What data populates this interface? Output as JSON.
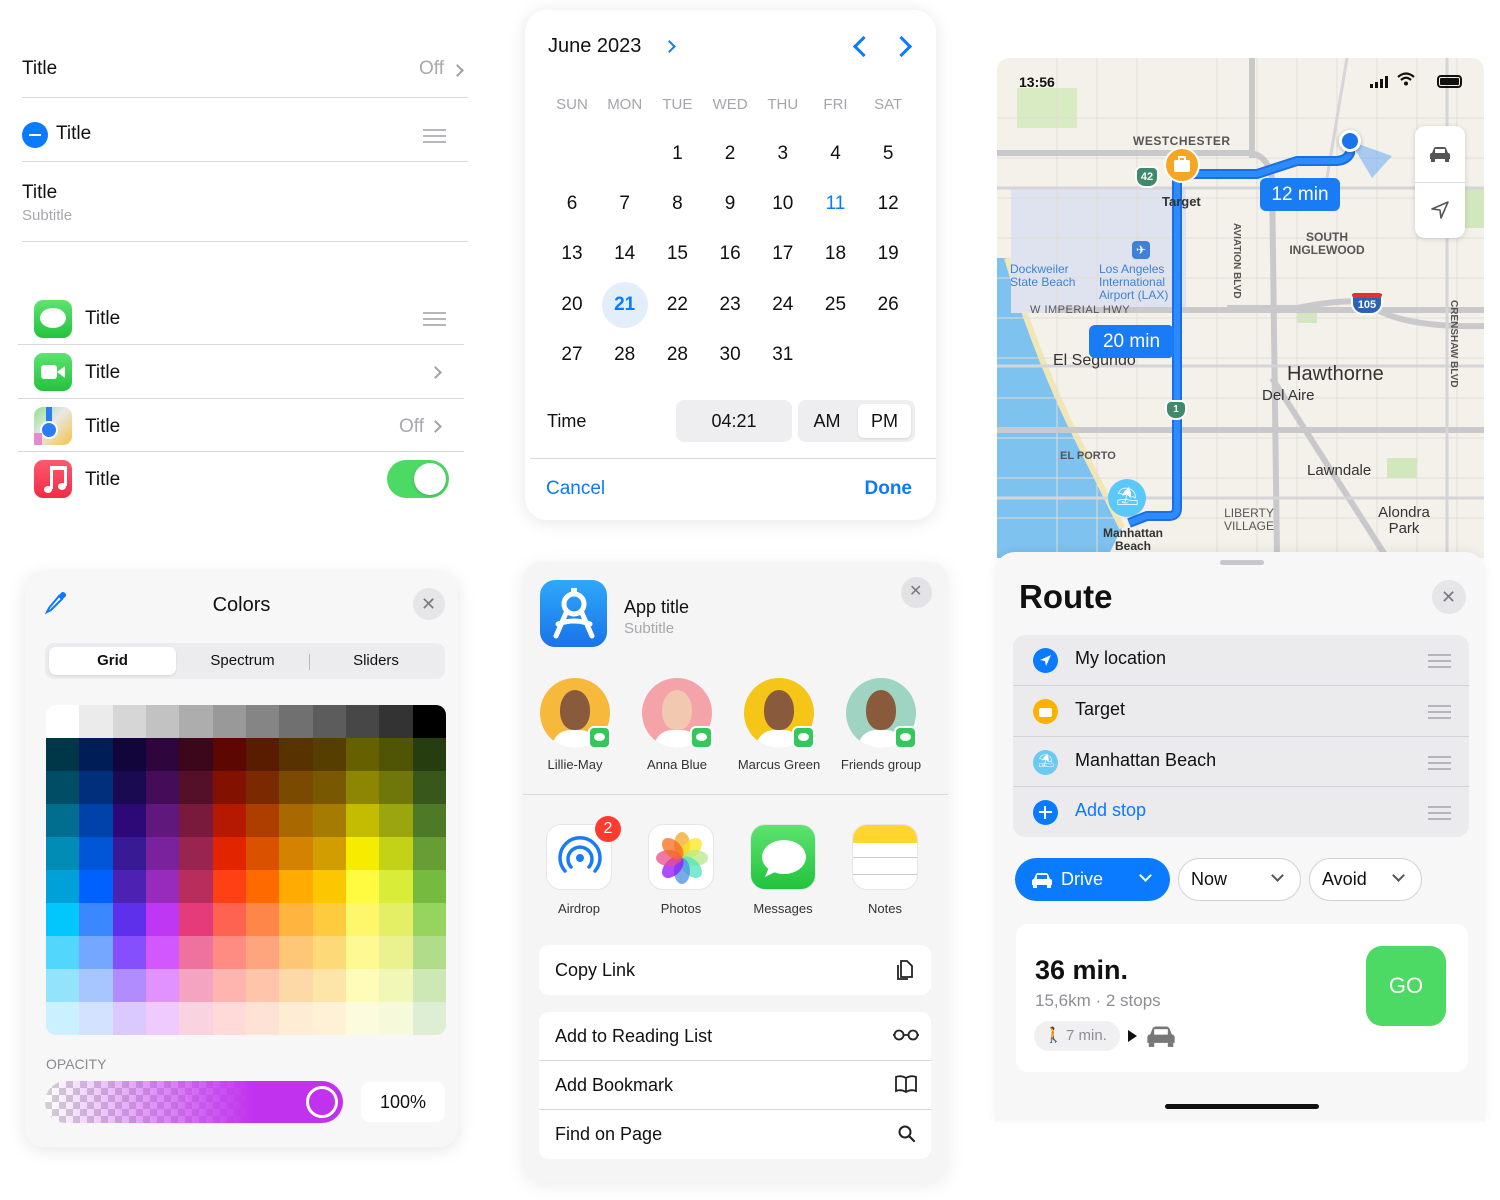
{
  "settings_list": {
    "rows": [
      {
        "title": "Title",
        "value": "Off"
      },
      {
        "title": "Title"
      },
      {
        "title": "Title",
        "subtitle": "Subtitle"
      }
    ],
    "app_rows": [
      {
        "title": "Title",
        "icon": "messages-icon",
        "accessory": "reorder"
      },
      {
        "title": "Title",
        "icon": "facetime-icon",
        "accessory": "chevron"
      },
      {
        "title": "Title",
        "icon": "maps-icon",
        "accessory": "value",
        "value": "Off"
      },
      {
        "title": "Title",
        "icon": "music-icon",
        "accessory": "toggle",
        "toggle_on": true
      }
    ]
  },
  "calendar": {
    "month_label": "June 2023",
    "weekdays": [
      "SUN",
      "MON",
      "TUE",
      "WED",
      "THU",
      "FRI",
      "SAT"
    ],
    "weeks": [
      [
        "",
        "",
        "1",
        "2",
        "3",
        "4",
        "5"
      ],
      [
        "6",
        "7",
        "8",
        "9",
        "10",
        "11",
        "12"
      ],
      [
        "13",
        "14",
        "15",
        "16",
        "17",
        "18",
        "19"
      ],
      [
        "20",
        "21",
        "22",
        "23",
        "24",
        "25",
        "26"
      ],
      [
        "27",
        "28",
        "28",
        "30",
        "31",
        "",
        ""
      ]
    ],
    "today": "11",
    "selected": "21",
    "time_label": "Time",
    "time_value": "04:21",
    "am_label": "AM",
    "pm_label": "PM",
    "selected_period": "PM",
    "cancel_label": "Cancel",
    "done_label": "Done"
  },
  "colors": {
    "title": "Colors",
    "tabs": [
      "Grid",
      "Spectrum",
      "Sliders"
    ],
    "active_tab": "Grid",
    "opacity_label": "OPACITY",
    "opacity_value": "100%",
    "opacity_fraction": 1.0,
    "selected_color": "#c132ee",
    "grayscale": [
      "#ffffff",
      "#ebebeb",
      "#d6d6d6",
      "#c2c2c2",
      "#adadad",
      "#999999",
      "#858585",
      "#707070",
      "#5c5c5c",
      "#474747",
      "#333333",
      "#000000"
    ],
    "grid": [
      [
        "#003748",
        "#011d57",
        "#11053b",
        "#2e063d",
        "#3c071b",
        "#5c0701",
        "#5a1c00",
        "#583300",
        "#563d00",
        "#666100",
        "#4f5504",
        "#263e0f"
      ],
      [
        "#004d65",
        "#012f7b",
        "#1a0a52",
        "#450d59",
        "#551029",
        "#831100",
        "#7b2900",
        "#7a4a00",
        "#785800",
        "#8c8602",
        "#6f760a",
        "#38571a"
      ],
      [
        "#016e8f",
        "#0042a9",
        "#2c0977",
        "#61187c",
        "#791a3d",
        "#b51a00",
        "#ad3e00",
        "#a96800",
        "#a67b01",
        "#c4bc00",
        "#9ba50e",
        "#4e7a27"
      ],
      [
        "#008cb4",
        "#0056d6",
        "#371a94",
        "#7a219e",
        "#99244f",
        "#e22400",
        "#da5100",
        "#d38301",
        "#d19d01",
        "#f5ec00",
        "#c3d117",
        "#669d34"
      ],
      [
        "#00a1d8",
        "#0061fe",
        "#4d22b2",
        "#982abc",
        "#b92d5d",
        "#ff4015",
        "#ff6a00",
        "#ffab01",
        "#fdc700",
        "#fefb41",
        "#d9ec37",
        "#76bb40"
      ],
      [
        "#01c7fc",
        "#3a87fe",
        "#5e30eb",
        "#be38f3",
        "#e63b7a",
        "#fe6250",
        "#fe8648",
        "#feb43f",
        "#fecb3e",
        "#fff76b",
        "#e4ef65",
        "#96d35f"
      ],
      [
        "#52d6fc",
        "#74a7ff",
        "#864ffe",
        "#d357fe",
        "#ee719e",
        "#ff8c82",
        "#fea57d",
        "#fec777",
        "#fed977",
        "#fff994",
        "#eaf28f",
        "#b1dd8b"
      ],
      [
        "#93e3fc",
        "#a7c6ff",
        "#b18cfe",
        "#e292fe",
        "#f4a4c0",
        "#ffb5af",
        "#ffc5ab",
        "#fed9a8",
        "#fde4a8",
        "#fffbb9",
        "#f1f7b7",
        "#cde8b5"
      ],
      [
        "#cbf0ff",
        "#d3e2ff",
        "#d9c9fe",
        "#efcaff",
        "#f9d3e0",
        "#ffdad8",
        "#ffe2d6",
        "#feecd4",
        "#fef1d5",
        "#fdfbdd",
        "#f6fadb",
        "#deeed4"
      ]
    ]
  },
  "share": {
    "app_title": "App title",
    "app_subtitle": "Subtitle",
    "contacts": [
      {
        "name": "Lillie-May",
        "bg": "#f6b93b"
      },
      {
        "name": "Anna Blue",
        "bg": "#f4a3a8"
      },
      {
        "name": "Marcus Green",
        "bg": "#f5c518"
      },
      {
        "name": "Friends group",
        "bg": "#9fd4c2"
      }
    ],
    "apps": [
      {
        "name": "Airdrop",
        "badge": "2"
      },
      {
        "name": "Photos"
      },
      {
        "name": "Messages"
      },
      {
        "name": "Notes"
      }
    ],
    "actions": [
      {
        "label": "Copy Link",
        "icon": "copy-icon"
      },
      {
        "label": "Add to Reading List",
        "icon": "glasses-icon"
      },
      {
        "label": "Add Bookmark",
        "icon": "book-icon"
      },
      {
        "label": "Find on Page",
        "icon": "search-icon"
      }
    ]
  },
  "map": {
    "status_time": "13:56",
    "eta_1": "12 min",
    "eta_2": "20 min",
    "labels": {
      "westchester": "WESTCHESTER",
      "target": "Target",
      "dockweiler": "Dockweiler State Beach",
      "lax": "Los Angeles International Airport (LAX)",
      "imperial": "W IMPERIAL HWY",
      "south_inglewood": "SOUTH INGLEWOOD",
      "aviation": "AVIATION BLVD",
      "crenshaw": "CRENSHAW BLVD",
      "el_segundo": "El Segundo",
      "hawthorne": "Hawthorne",
      "del_aire": "Del Aire",
      "el_porto": "EL PORTO",
      "lawndale": "Lawndale",
      "liberty": "LIBERTY VILLAGE",
      "alondra": "Alondra Park",
      "manhattan": "Manhattan Beach",
      "hwy42": "42",
      "hwy1": "1",
      "i105": "105"
    }
  },
  "route": {
    "title": "Route",
    "stops": [
      {
        "label": "My location",
        "color": "#0a7aff"
      },
      {
        "label": "Target",
        "color": "#ffb000"
      },
      {
        "label": "Manhattan Beach",
        "color": "#5ac8fa"
      },
      {
        "label": "Add stop",
        "color": "#0a7aff"
      }
    ],
    "mode_label": "Drive",
    "time_label": "Now",
    "avoid_label": "Avoid",
    "duration": "36 min.",
    "details": "15,6km · 2 stops",
    "walk": "7 min.",
    "go_label": "GO"
  }
}
